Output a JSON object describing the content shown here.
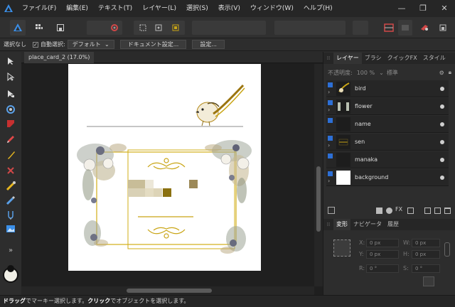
{
  "menu": [
    "ファイル(F)",
    "編集(E)",
    "テキスト(T)",
    "レイヤー(L)",
    "選択(S)",
    "表示(V)",
    "ウィンドウ(W)",
    "ヘルプ(H)"
  ],
  "window_controls": {
    "minimize": "—",
    "restore": "❐",
    "close": "✕"
  },
  "context": {
    "deselect": "選択なし",
    "auto_select_label": "自動選択:",
    "auto_select_value": "デフォルト",
    "doc_settings": "ドキュメント設定...",
    "settings": "設定..."
  },
  "document_tab": "place_card_2 (17.0%)",
  "panels": {
    "top_tabs": [
      "レイヤー",
      "ブラシ",
      "クイックFX",
      "スタイル"
    ],
    "opacity_label": "不透明度:",
    "opacity_value": "100 %",
    "blend_mode": "標準",
    "layers": [
      {
        "name": "bird"
      },
      {
        "name": "flower"
      },
      {
        "name": "name"
      },
      {
        "name": "sen"
      },
      {
        "name": "manaka"
      },
      {
        "name": "background"
      }
    ],
    "bottom_tabs": [
      "変形",
      "ナビゲータ",
      "履歴"
    ],
    "transform": {
      "x_label": "X:",
      "x_value": "0 px",
      "y_label": "Y:",
      "y_value": "0 px",
      "w_label": "W:",
      "w_value": "0 px",
      "h_label": "H:",
      "h_value": "0 px",
      "r_label": "R:",
      "r_value": "0 °",
      "s_label": "S:",
      "s_value": "0 °"
    }
  },
  "status": {
    "drag": "ドラッグ",
    "drag_text": "でマーキー選択します。",
    "click": "クリック",
    "click_text": "でオブジェクトを選択します。"
  },
  "colors": {
    "accent_blue": "#2d6fd6",
    "gold": "#c9a515",
    "sage": "#8d9a7a"
  }
}
